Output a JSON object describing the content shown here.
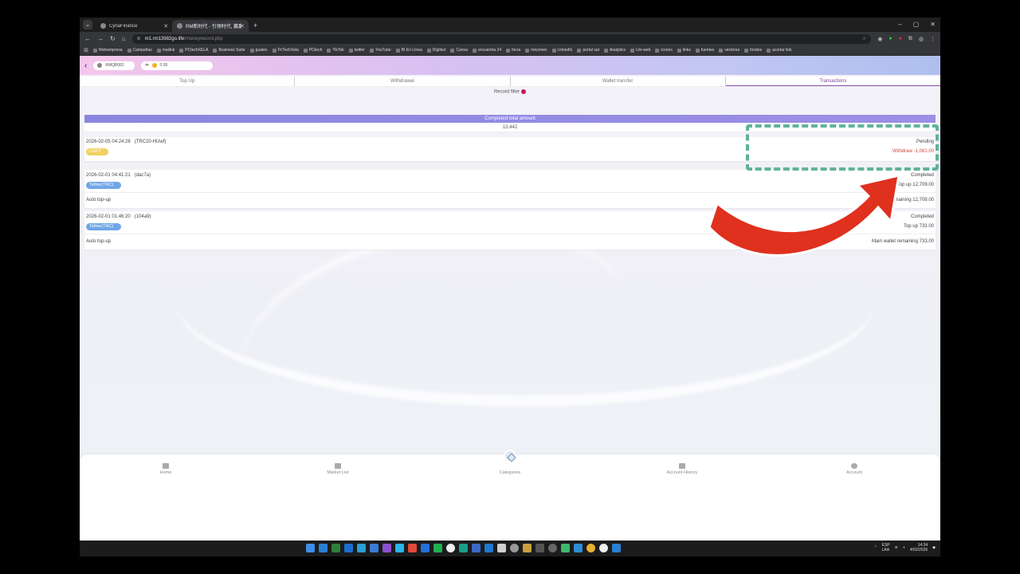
{
  "browser": {
    "tabs": [
      {
        "title": "CynaFinance",
        "active": false
      },
      {
        "title": "RM新时代 - 引领时代, 赢赢未来",
        "active": true
      }
    ],
    "new_tab": "+",
    "window_controls": [
      "–",
      "▢",
      "✕"
    ],
    "url_host": "m1.rm13982go.life",
    "url_path": "/moneyrecord.php",
    "bookmarks": [
      "Webempresa",
      "Campañas",
      "mailink",
      "PCtechXELA",
      "Business Suite",
      "guates",
      "PcTechXela",
      "PCtech",
      "TikTok",
      "twitter",
      "YouTube",
      "BI En Línea",
      "Digifact",
      "Canva",
      "encuentra 24",
      "forza",
      "mtcomex",
      "LinkedIn",
      "portal sat",
      "Analytics",
      "Uni-web",
      "iconos",
      "links",
      "fuentes",
      "vectores",
      "fondos",
      "acortar link"
    ]
  },
  "appbar": {
    "user": "RMQB081",
    "balance": "0.95"
  },
  "tabs": [
    "Top Up",
    "Withdrawal",
    "Wallet transfer",
    "Transactions"
  ],
  "filter_label": "Record filter",
  "total": {
    "label": "Completed total amount",
    "value": "13,442"
  },
  "records": [
    {
      "datetime": "2026-02-05 04:24:28",
      "ref": "(TRC20-HUwf)",
      "badge": "USDT",
      "status": "Pending",
      "amount": "Withdraw -1,061.00",
      "note": "",
      "remaining": ""
    },
    {
      "datetime": "2026-02-01 04:41:21",
      "ref": "(dac7a)",
      "badge": "Tether(TRC)",
      "status": "Completed",
      "amount": "Top up 12,709.00",
      "note": "Auto top-up",
      "remaining": "emaining   12,709.00"
    },
    {
      "datetime": "2026-02-01 01:46:20",
      "ref": "(104a9)",
      "badge": "Tether(TRC)",
      "status": "Completed",
      "amount": "Top up 733.00",
      "note": "Auto top-up",
      "remaining": "Main wallet remaining   733.00"
    }
  ],
  "bottom_nav": [
    "Home",
    "Market List",
    "Categories",
    "Account History",
    "Account"
  ],
  "taskbar": {
    "lang": "ESP\nLAA",
    "time": "14:34",
    "date": "4/02/2026"
  },
  "colors": {
    "accent": "#8a4fb0",
    "withdraw_red": "#d0463c",
    "badge_blue": "#6fa6e8",
    "badge_yellow": "#f0d060",
    "annotation_green": "#5fb39a",
    "annotation_arrow": "#e0301e"
  }
}
